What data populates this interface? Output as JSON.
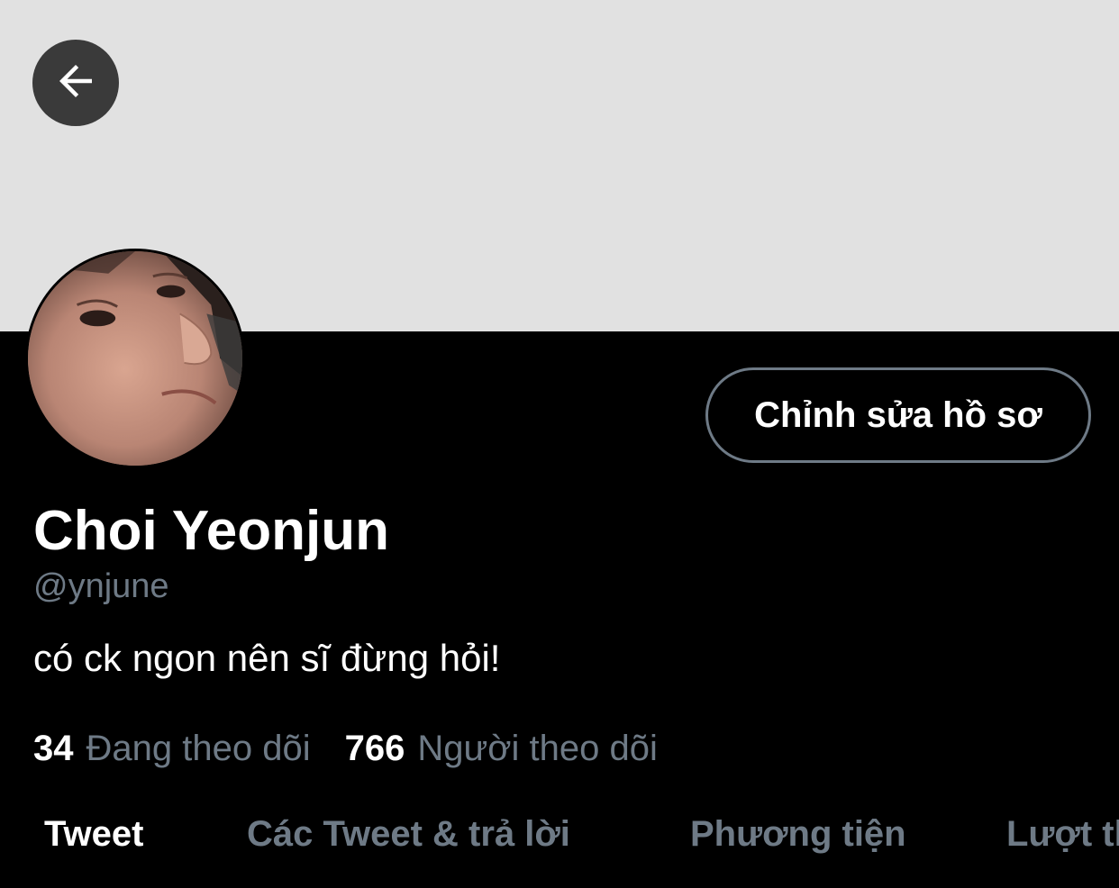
{
  "header": {
    "back_icon": "arrow-left-icon"
  },
  "profile": {
    "avatar_alt": "profile photo",
    "edit_button_label": "Chỉnh sửa hồ sơ",
    "display_name": "Choi Yeonjun",
    "handle": "@ynjune",
    "bio": "có ck ngon nên sĩ đừng hỏi!",
    "following_count": "34",
    "following_label": "Đang theo dõi",
    "followers_count": "766",
    "followers_label": "Người theo dõi"
  },
  "tabs": [
    {
      "label": "Tweet",
      "active": true
    },
    {
      "label": "Các Tweet & trả lời",
      "active": false
    },
    {
      "label": "Phương tiện",
      "active": false
    },
    {
      "label": "Lượt thích",
      "active": false
    }
  ],
  "colors": {
    "background": "#000000",
    "banner": "#e1e1e1",
    "secondary_text": "#6e7a86",
    "primary_text": "#ffffff"
  }
}
